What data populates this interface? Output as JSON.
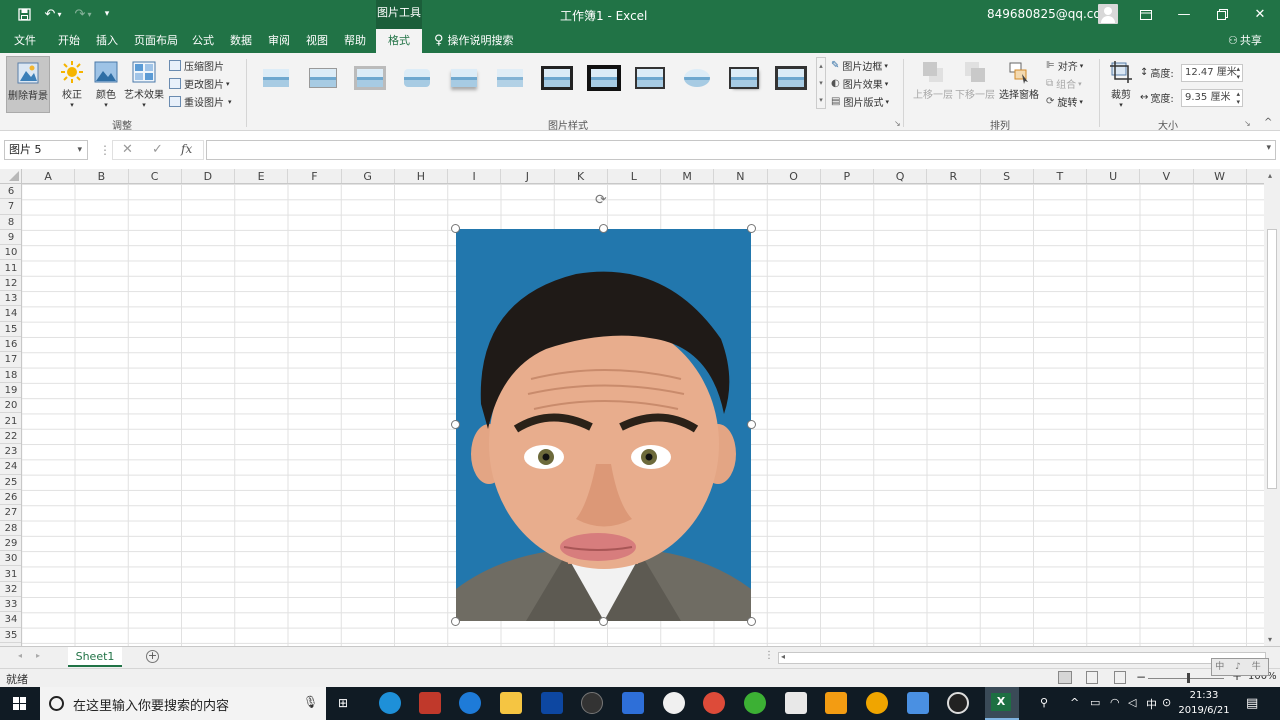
{
  "titlebar": {
    "picture_tools": "图片工具",
    "title": "工作簿1 - Excel",
    "account": "849680825@qq.com"
  },
  "menu": {
    "tabs": [
      "文件",
      "开始",
      "插入",
      "页面布局",
      "公式",
      "数据",
      "审阅",
      "视图",
      "帮助"
    ],
    "active_tab": "格式",
    "tell_me": "操作说明搜索",
    "share": "共享"
  },
  "ribbon": {
    "adjust": {
      "remove_bg": "删除背景",
      "corrections": "校正",
      "color": "颜色",
      "artistic": "艺术效果",
      "compress": "压缩图片",
      "change": "更改图片",
      "reset": "重设图片",
      "group_label": "调整"
    },
    "styles": {
      "group_label": "图片样式",
      "border": "图片边框",
      "effects": "图片效果",
      "layout": "图片版式"
    },
    "arrange": {
      "group_label": "排列",
      "bring_forward": "上移一层",
      "send_backward": "下移一层",
      "selection_pane": "选择窗格",
      "align": "对齐",
      "group": "组合",
      "rotate": "旋转"
    },
    "size": {
      "group_label": "大小",
      "crop": "裁剪",
      "height_label": "高度:",
      "height_value": "12.47 厘米",
      "width_label": "宽度:",
      "width_value": "9.35 厘米"
    }
  },
  "formula_bar": {
    "name_box": "图片 5",
    "fx": "fx",
    "formula": ""
  },
  "grid": {
    "columns": [
      "A",
      "B",
      "C",
      "D",
      "E",
      "F",
      "G",
      "H",
      "I",
      "J",
      "K",
      "L",
      "M",
      "N",
      "O",
      "P",
      "Q",
      "R",
      "S",
      "T",
      "U",
      "V",
      "W"
    ],
    "rows": [
      "6",
      "7",
      "8",
      "9",
      "10",
      "11",
      "12",
      "13",
      "14",
      "15",
      "16",
      "17",
      "18",
      "19",
      "20",
      "21",
      "22",
      "23",
      "24",
      "25",
      "26",
      "27",
      "28",
      "29",
      "30",
      "31",
      "32",
      "33",
      "34",
      "35"
    ]
  },
  "sheet_tabs": {
    "sheet1": "Sheet1"
  },
  "status": {
    "ready": "就绪",
    "zoom": "100%",
    "ime": "中 ♪ 牛"
  },
  "taskbar": {
    "search_placeholder": "在这里输入你要搜索的内容",
    "time": "21:33",
    "date": "2019/6/21",
    "ime_lang": "中"
  },
  "colors": {
    "excel_green": "#217346",
    "picture_bg": "#2277ad"
  }
}
